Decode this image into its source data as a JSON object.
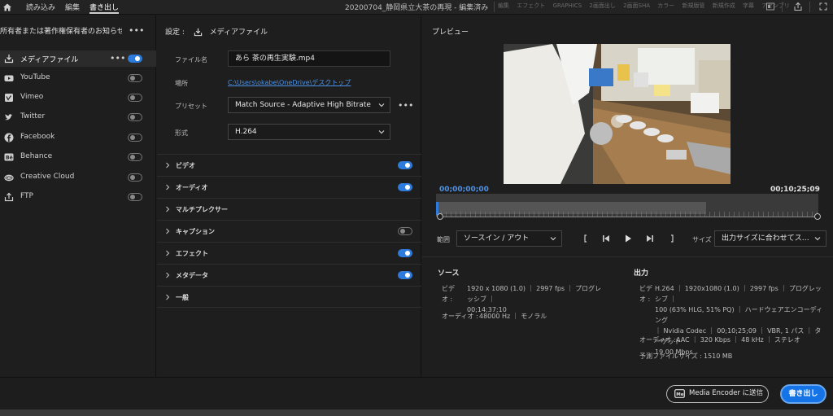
{
  "topbar": {
    "nav": [
      "読み込み",
      "編集",
      "書き出し"
    ],
    "title": "20200704_静岡県立大茶の再現 - 編集済み",
    "workspaces": [
      "編集",
      "エフェクト",
      "GRAPHICS",
      "2画面出し",
      "2画面SHA",
      "カラー",
      "新規版管",
      "新規作成",
      "字幕",
      "アセンブリ"
    ]
  },
  "left": {
    "header": "所有者または著作権保有者のお知らせ 茶の再…",
    "destinations": [
      {
        "label": "メディアファイル",
        "icon": "download-icon",
        "on": true
      },
      {
        "label": "YouTube",
        "icon": "youtube-icon",
        "on": false
      },
      {
        "label": "Vimeo",
        "icon": "vimeo-icon",
        "on": false
      },
      {
        "label": "Twitter",
        "icon": "twitter-icon",
        "on": false
      },
      {
        "label": "Facebook",
        "icon": "facebook-icon",
        "on": false
      },
      {
        "label": "Behance",
        "icon": "behance-icon",
        "on": false
      },
      {
        "label": "Creative Cloud",
        "icon": "creative-cloud-icon",
        "on": false
      },
      {
        "label": "FTP",
        "icon": "ftp-icon",
        "on": false
      }
    ]
  },
  "settings": {
    "title": "設定 :",
    "subtitle": "メディアファイル",
    "filename_label": "ファイル名",
    "filename_value": "あら 茶の再生実験.mp4",
    "location_label": "場所",
    "location_value": "C:\\Users\\okabe\\OneDrive\\デスクトップ",
    "preset_label": "プリセット",
    "preset_value": "Match Source - Adaptive High Bitrate",
    "format_label": "形式",
    "format_value": "H.264",
    "sections": [
      {
        "label": "ビデオ",
        "toggle": true,
        "on": true
      },
      {
        "label": "オーディオ",
        "toggle": true,
        "on": true
      },
      {
        "label": "マルチプレクサー",
        "toggle": false,
        "on": false
      },
      {
        "label": "キャプション",
        "toggle": true,
        "on": false
      },
      {
        "label": "エフェクト",
        "toggle": true,
        "on": true
      },
      {
        "label": "メタデータ",
        "toggle": true,
        "on": true
      },
      {
        "label": "一般",
        "toggle": false,
        "on": false
      }
    ]
  },
  "preview": {
    "title": "プレビュー",
    "tc_start": "00;00;00;00",
    "tc_end": "00;10;25;09",
    "range_label": "範囲",
    "range_value": "ソースイン / アウト",
    "size_label": "サイズ",
    "size_value": "出力サイズに合わせてス…",
    "source_title": "ソース",
    "source_video_label": "ビデオ :",
    "source_video_line1": "1920 x 1080 (1.0) ｜ 2997 fps ｜ プログレッシブ ｜",
    "source_video_line2": "00;14;37;10",
    "source_audio_label": "オーディオ :",
    "source_audio_value": "48000 Hz ｜ モノラル",
    "output_title": "出力",
    "output_video_label": "ビデオ :",
    "output_video_line1": "H.264 ｜ 1920x1080 (1.0) ｜ 2997 fps ｜ プログレッシブ ｜",
    "output_video_line2": "100 (63% HLG, 51% PQ) ｜ ハードウェアエンコーディング",
    "output_video_line3": "｜ Nvidia Codec ｜ 00;10;25;09 ｜ VBR, 1 パス ｜ ターゲット",
    "output_video_line4": "19.00 Mbps",
    "output_audio_label": "オーディオ :",
    "output_audio_value": "AAC ｜ 320 Kbps ｜ 48 kHz ｜ ステレオ",
    "filesize_label": "予測ファイルサイズ :",
    "filesize_value": "1510 MB"
  },
  "footer": {
    "media_encoder_label": "Media Encoder に送信",
    "export_label": "書き出し"
  },
  "colors": {
    "accent": "#1473e6",
    "toggle_on": "#2d7bdc",
    "link": "#4b92e6"
  }
}
